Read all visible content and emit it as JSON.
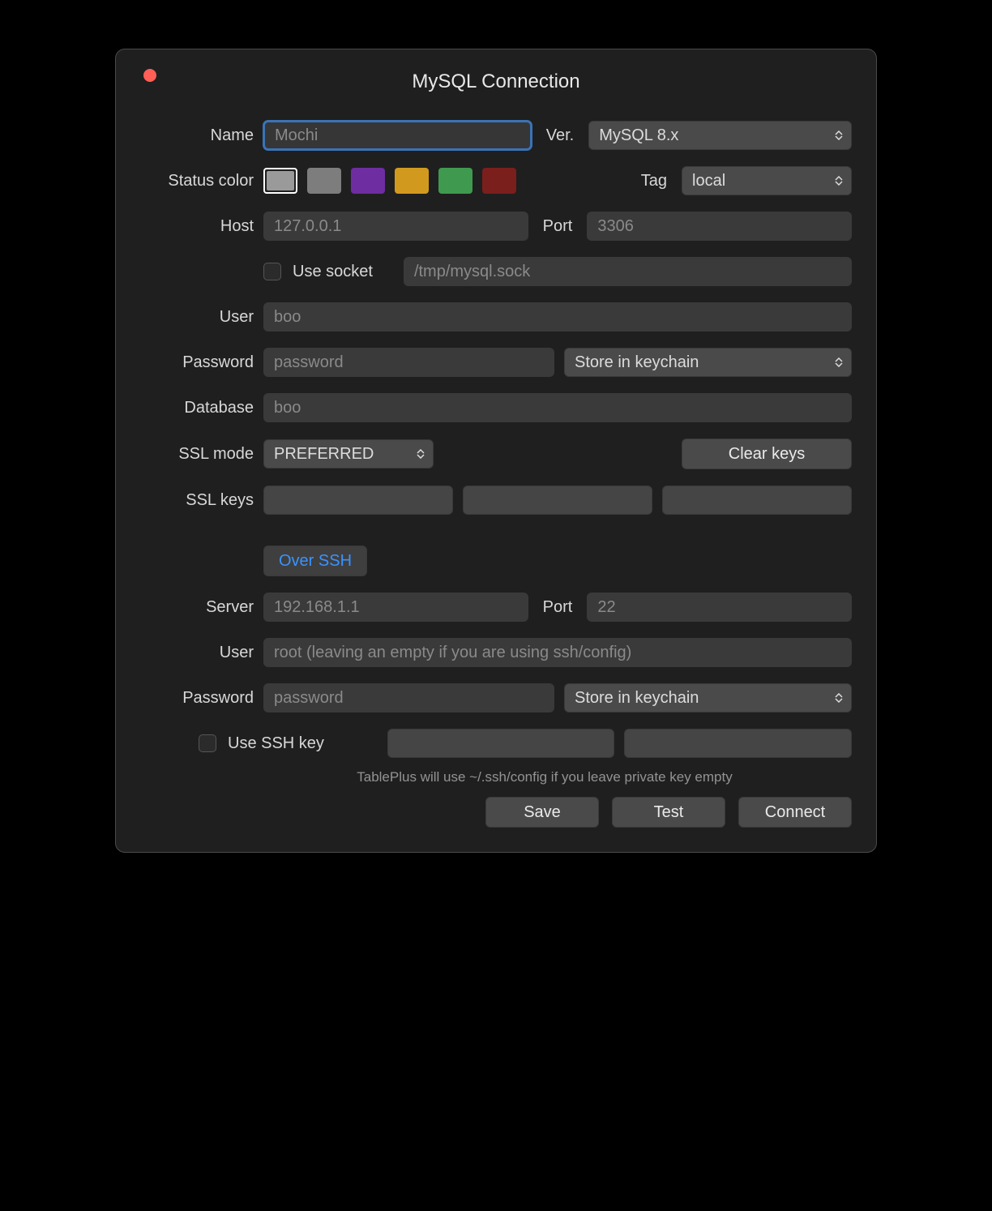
{
  "title": "MySQL Connection",
  "labels": {
    "name": "Name",
    "ver": "Ver.",
    "status_color": "Status color",
    "tag": "Tag",
    "host": "Host",
    "port": "Port",
    "use_socket": "Use socket",
    "user": "User",
    "password": "Password",
    "database": "Database",
    "ssl_mode": "SSL mode",
    "ssl_keys": "SSL keys",
    "clear_keys": "Clear keys",
    "over_ssh": "Over SSH",
    "server": "Server",
    "ssh_port": "Port",
    "ssh_user": "User",
    "ssh_password": "Password",
    "use_ssh_key": "Use SSH key"
  },
  "fields": {
    "name_placeholder": "Mochi",
    "version": "MySQL 8.x",
    "tag": "local",
    "host_placeholder": "127.0.0.1",
    "port_placeholder": "3306",
    "socket_placeholder": "/tmp/mysql.sock",
    "user_placeholder": "boo",
    "password_placeholder": "password",
    "password_store": "Store in keychain",
    "database_placeholder": "boo",
    "ssl_mode": "PREFERRED",
    "ssh_server_placeholder": "192.168.1.1",
    "ssh_port_placeholder": "22",
    "ssh_user_placeholder": "root (leaving an empty if you are using ssh/config)",
    "ssh_password_placeholder": "password",
    "ssh_password_store": "Store in keychain"
  },
  "status_colors": [
    "#9a9a9a",
    "#7d7d7d",
    "#6e2da0",
    "#d19a1f",
    "#3f9a4f",
    "#7a1f1c"
  ],
  "hint": "TablePlus will use ~/.ssh/config if you leave private key empty",
  "buttons": {
    "save": "Save",
    "test": "Test",
    "connect": "Connect"
  }
}
